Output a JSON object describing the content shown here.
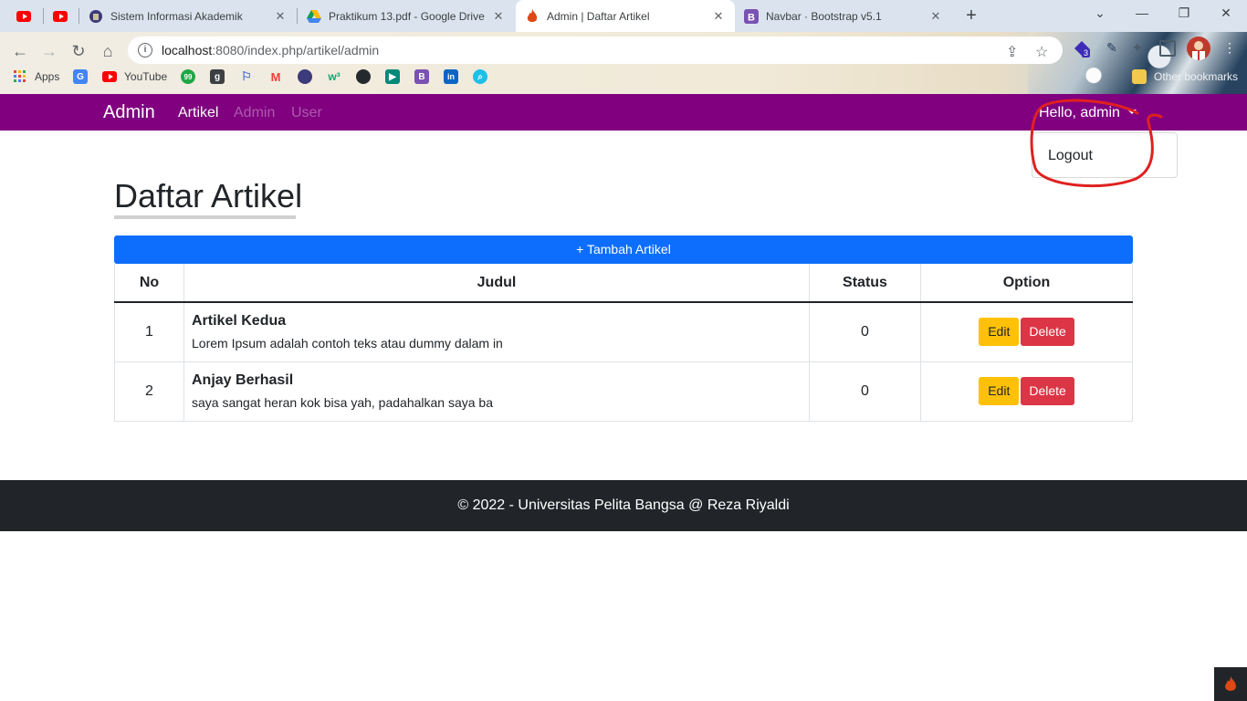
{
  "browser": {
    "tabs": [
      {
        "title": "",
        "icon": "youtube-icon"
      },
      {
        "title": "",
        "icon": "youtube-icon"
      },
      {
        "title": "Sistem Informasi Akademik",
        "icon": "campus-logo-icon"
      },
      {
        "title": "Praktikum 13.pdf - Google Drive",
        "icon": "google-drive-icon"
      },
      {
        "title": "Admin | Daftar Artikel",
        "icon": "codeigniter-icon",
        "active": true
      },
      {
        "title": "Navbar · Bootstrap v5.1",
        "icon": "bootstrap-icon"
      }
    ],
    "url_host": "localhost",
    "url_path": ":8080/index.php/artikel/admin",
    "extension_badge": "3",
    "bookmarks": [
      {
        "label": "Apps",
        "icon": "apps-grid-icon"
      },
      {
        "label": "",
        "icon": "google-translate-icon"
      },
      {
        "label": "YouTube",
        "icon": "youtube-icon"
      },
      {
        "label": "",
        "icon": "99-icon"
      },
      {
        "label": "",
        "icon": "goodreads-icon"
      },
      {
        "label": "",
        "icon": "flag-icon"
      },
      {
        "label": "",
        "icon": "gmail-icon"
      },
      {
        "label": "",
        "icon": "campus-logo-icon"
      },
      {
        "label": "",
        "icon": "w3schools-icon"
      },
      {
        "label": "",
        "icon": "github-icon"
      },
      {
        "label": "",
        "icon": "google-meet-icon"
      },
      {
        "label": "",
        "icon": "bootstrap-icon"
      },
      {
        "label": "",
        "icon": "linkedin-icon"
      },
      {
        "label": "",
        "icon": "search-app-icon"
      }
    ],
    "other_bookmarks": "Other bookmarks"
  },
  "navbar": {
    "brand": "Admin",
    "links": [
      {
        "label": "Artikel",
        "active": true
      },
      {
        "label": "Admin",
        "active": false
      },
      {
        "label": "User",
        "active": false
      }
    ],
    "user_label": "Hello, admin",
    "dropdown_items": [
      "Logout"
    ],
    "color": "#800080"
  },
  "page": {
    "heading": "Daftar Artikel",
    "add_button": "+ Tambah Artikel",
    "columns": [
      "No",
      "Judul",
      "Status",
      "Option"
    ],
    "rows": [
      {
        "no": "1",
        "title": "Artikel Kedua",
        "excerpt": "Lorem Ipsum adalah contoh teks atau dummy dalam in",
        "status": "0",
        "edit": "Edit",
        "delete": "Delete"
      },
      {
        "no": "2",
        "title": "Anjay Berhasil",
        "excerpt": "saya sangat heran kok bisa yah, padahalkan saya ba",
        "status": "0",
        "edit": "Edit",
        "delete": "Delete"
      }
    ]
  },
  "footer": {
    "text": "© 2022 - Universitas Pelita Bangsa @ Reza Riyaldi"
  },
  "colors": {
    "primary": "#0d6efd",
    "warning": "#ffc107",
    "danger": "#dc3545",
    "footer_bg": "#212529",
    "annotation": "#e02020"
  }
}
